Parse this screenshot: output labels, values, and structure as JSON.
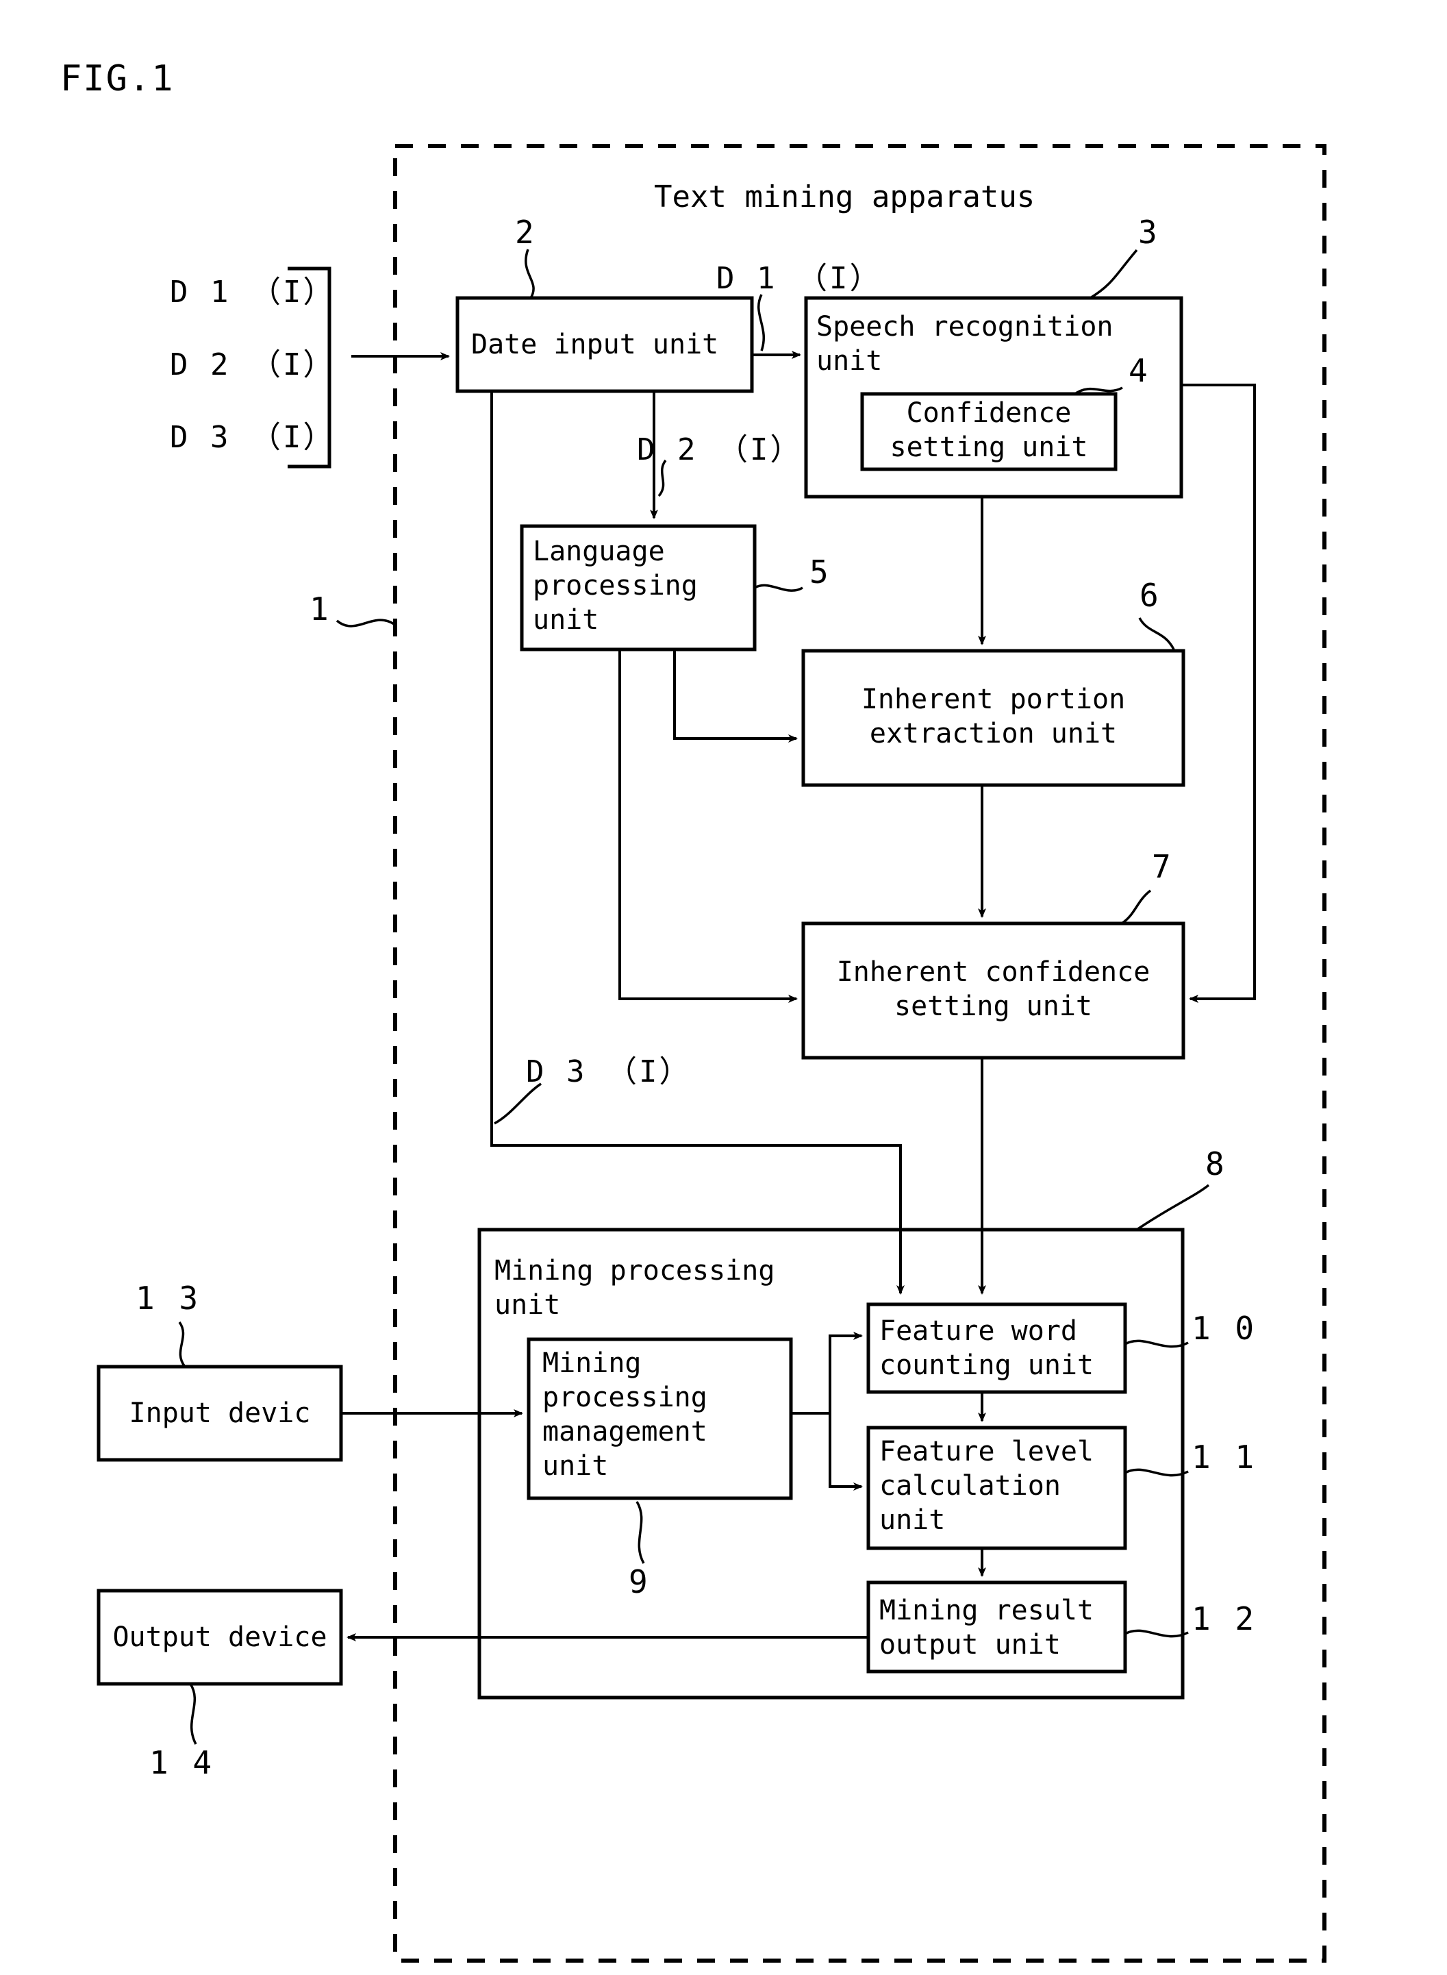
{
  "figure": {
    "label": "FIG.1",
    "apparatus_title": "Text mining apparatus"
  },
  "inputs": {
    "items": [
      {
        "label": "D 1 （I）"
      },
      {
        "label": "D 2 （I）"
      },
      {
        "label": "D 3 （I）"
      }
    ]
  },
  "signals": {
    "d1": "D 1 （I）",
    "d2": "D 2 （I）",
    "d3": "D 3 （I）"
  },
  "blocks": {
    "date_input_unit": {
      "label": "Date input unit",
      "ref": "2"
    },
    "speech_recognition_unit": {
      "label": "Speech recognition\nunit",
      "ref": "3"
    },
    "confidence_setting_unit": {
      "label": "Confidence\nsetting unit",
      "ref": "4"
    },
    "language_processing_unit": {
      "label": "Language\nprocessing\nunit",
      "ref": "5"
    },
    "inherent_portion_extraction_unit": {
      "label": "Inherent portion\nextraction unit",
      "ref": "6"
    },
    "inherent_confidence_setting_unit": {
      "label": "Inherent confidence\nsetting unit",
      "ref": "7"
    },
    "mining_processing_unit": {
      "label": "Mining processing\nunit",
      "ref": "8"
    },
    "mining_processing_management_unit": {
      "label": "Mining\nprocessing\nmanagement\nunit",
      "ref": "9"
    },
    "feature_word_counting_unit": {
      "label": "Feature word\ncounting unit",
      "ref": "1 0"
    },
    "feature_level_calculation_unit": {
      "label": "Feature level\ncalculation\nunit",
      "ref": "1 1"
    },
    "mining_result_output_unit": {
      "label": "Mining result\noutput unit",
      "ref": "1 2"
    },
    "input_device": {
      "label": "Input devic",
      "ref": "1 3"
    },
    "output_device": {
      "label": "Output device",
      "ref": "1 4"
    },
    "apparatus_boundary": {
      "ref": "1"
    }
  },
  "colors": {
    "stroke": "#000000",
    "background": "#ffffff"
  }
}
